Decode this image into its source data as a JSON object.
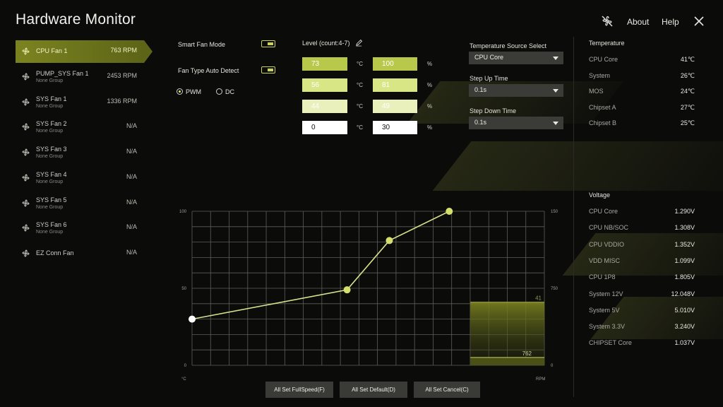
{
  "app": {
    "title": "Hardware Monitor",
    "about": "About",
    "help": "Help"
  },
  "icons": {
    "header_left": "fan-off-icon",
    "close": "close-icon",
    "fan": "fan-icon",
    "edit": "pencil-icon",
    "dropdown": "chevron-down-icon"
  },
  "colors": {
    "accent": "#c9d25a",
    "selected": "#7b8320",
    "level_1": "#b7c84a",
    "level_2": "#d8e686",
    "level_3": "#e9f0bb",
    "level_4": "#ffffff"
  },
  "fans": [
    {
      "name": "CPU Fan 1",
      "group": "",
      "rpm": "763 RPM",
      "selected": true
    },
    {
      "name": "PUMP_SYS Fan 1",
      "group": "None Group",
      "rpm": "2453 RPM"
    },
    {
      "name": "SYS Fan 1",
      "group": "None Group",
      "rpm": "1336 RPM"
    },
    {
      "name": "SYS Fan 2",
      "group": "None Group",
      "rpm": "N/A"
    },
    {
      "name": "SYS Fan 3",
      "group": "None Group",
      "rpm": "N/A"
    },
    {
      "name": "SYS Fan 4",
      "group": "None Group",
      "rpm": "N/A"
    },
    {
      "name": "SYS Fan 5",
      "group": "None Group",
      "rpm": "N/A"
    },
    {
      "name": "SYS Fan 6",
      "group": "None Group",
      "rpm": "N/A"
    },
    {
      "name": "EZ Conn Fan",
      "group": "",
      "rpm": "N/A"
    }
  ],
  "controls": {
    "smart_fan_mode": {
      "label": "Smart Fan Mode",
      "on": true
    },
    "fan_type_auto": {
      "label": "Fan Type Auto Detect",
      "on": true
    },
    "pwm_label": "PWM",
    "dc_label": "DC",
    "mode": "PWM"
  },
  "levels": {
    "title": "Level (count:4-7)",
    "temp_unit": "°C",
    "pct_unit": "%",
    "rows": [
      {
        "temp": "73",
        "pct": "100"
      },
      {
        "temp": "56",
        "pct": "81"
      },
      {
        "temp": "44",
        "pct": "49"
      },
      {
        "temp": "0",
        "pct": "30"
      }
    ]
  },
  "temp_source": {
    "label": "Temperature Source Select",
    "value": "CPU Core"
  },
  "step_up": {
    "label": "Step Up Time",
    "value": "0.1s"
  },
  "step_down": {
    "label": "Step Down Time",
    "value": "0.1s"
  },
  "temperature": {
    "title": "Temperature",
    "items": [
      {
        "label": "CPU Core",
        "value": "41℃"
      },
      {
        "label": "System",
        "value": "26℃"
      },
      {
        "label": "MOS",
        "value": "24℃"
      },
      {
        "label": "Chipset A",
        "value": "27℃"
      },
      {
        "label": "Chipset B",
        "value": "25℃"
      }
    ]
  },
  "voltage": {
    "title": "Voltage",
    "items": [
      {
        "label": "CPU Core",
        "value": "1.290V"
      },
      {
        "label": "CPU NB/SOC",
        "value": "1.308V"
      },
      {
        "label": "CPU VDDIO",
        "value": "1.352V"
      },
      {
        "label": "VDD MISC",
        "value": "1.099V"
      },
      {
        "label": "CPU 1P8",
        "value": "1.805V"
      },
      {
        "label": "System 12V",
        "value": "12.048V"
      },
      {
        "label": "System 5V",
        "value": "5.010V"
      },
      {
        "label": "System 3.3V",
        "value": "3.240V"
      },
      {
        "label": "CHIPSET Core",
        "value": "1.037V"
      }
    ]
  },
  "buttons": {
    "full_speed": "All Set FullSpeed(F)",
    "default": "All Set Default(D)",
    "cancel": "All Set Cancel(C)"
  },
  "chart_data": {
    "type": "line",
    "x_unit": "°C",
    "y_left": {
      "ticks": [
        "100",
        "50",
        "0"
      ],
      "range": [
        0,
        100
      ]
    },
    "y_right": {
      "ticks": [
        "15000",
        "7500",
        "0"
      ],
      "unit": "RPM",
      "range": [
        0,
        15000
      ]
    },
    "x_range": [
      0,
      100
    ],
    "points": [
      {
        "x": 0,
        "y": 30
      },
      {
        "x": 44,
        "y": 49
      },
      {
        "x": 56,
        "y": 81
      },
      {
        "x": 73,
        "y": 100
      }
    ],
    "live_temp": "41",
    "live_rpm": "762",
    "live_temp_value": 41,
    "live_rpm_value": 762,
    "grid": true
  }
}
